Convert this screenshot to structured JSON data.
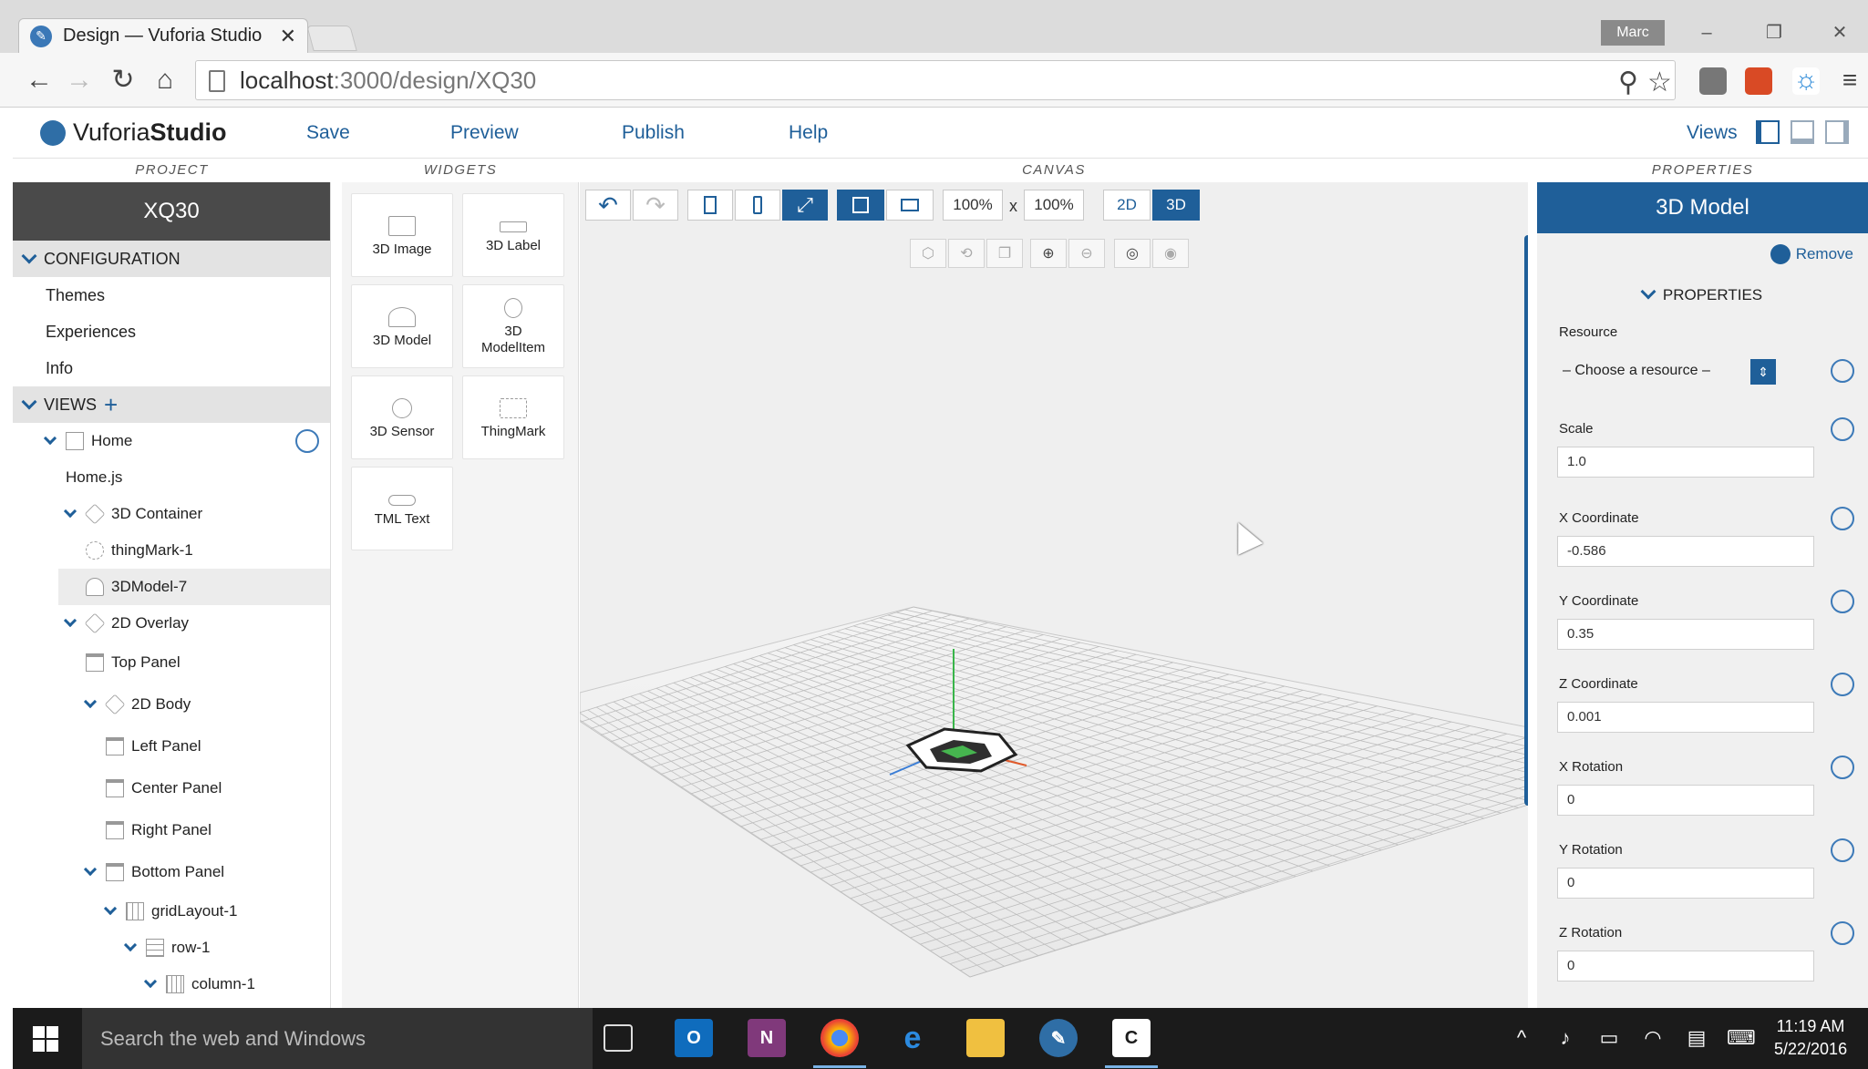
{
  "browser": {
    "tab_title": "Design — Vuforia Studio",
    "tab_close": "✕",
    "user": "Marc",
    "url_host": "localhost",
    "url_path": ":3000/design/XQ30"
  },
  "app": {
    "logo_prefix": "Vuforia",
    "logo_suffix": "Studio",
    "menu": {
      "save": "Save",
      "preview": "Preview",
      "publish": "Publish",
      "help": "Help"
    },
    "views_label": "Views"
  },
  "columns": {
    "project": "PROJECT",
    "widgets": "WIDGETS",
    "canvas": "CANVAS",
    "properties": "PROPERTIES"
  },
  "project": {
    "name": "XQ30",
    "configuration_label": "CONFIGURATION",
    "configuration_items": [
      "Themes",
      "Experiences",
      "Info"
    ],
    "views_label": "VIEWS",
    "tree": {
      "home": "Home",
      "home_js": "Home.js",
      "container_3d": "3D Container",
      "thingmark": "thingMark-1",
      "model": "3DModel-7",
      "overlay_2d": "2D Overlay",
      "top_panel": "Top Panel",
      "body_2d": "2D Body",
      "left_panel": "Left Panel",
      "center_panel": "Center Panel",
      "right_panel": "Right Panel",
      "bottom_panel": "Bottom Panel",
      "grid_layout": "gridLayout-1",
      "row": "row-1",
      "column": "column-1"
    }
  },
  "widgets": [
    {
      "label1": "3D Image",
      "label2": ""
    },
    {
      "label1": "3D Label",
      "label2": ""
    },
    {
      "label1": "3D Model",
      "label2": ""
    },
    {
      "label1": "3D",
      "label2": "ModelItem"
    },
    {
      "label1": "3D Sensor",
      "label2": ""
    },
    {
      "label1": "ThingMark",
      "label2": ""
    },
    {
      "label1": "TML Text",
      "label2": ""
    }
  ],
  "canvas": {
    "zoom_width": "100%",
    "zoom_height": "100%",
    "times": "x",
    "mode_2d": "2D",
    "mode_3d": "3D"
  },
  "properties": {
    "title": "3D Model",
    "remove": "Remove",
    "section": "PROPERTIES",
    "resource_label": "Resource",
    "resource_value": "– Choose a resource –",
    "fields": [
      {
        "label": "Scale",
        "value": "1.0"
      },
      {
        "label": "X Coordinate",
        "value": "-0.586"
      },
      {
        "label": "Y Coordinate",
        "value": "0.35"
      },
      {
        "label": "Z Coordinate",
        "value": "0.001"
      },
      {
        "label": "X Rotation",
        "value": "0"
      },
      {
        "label": "Y Rotation",
        "value": "0"
      },
      {
        "label": "Z Rotation",
        "value": "0"
      }
    ]
  },
  "taskbar": {
    "search_placeholder": "Search the web and Windows",
    "time": "11:19 AM",
    "date": "5/22/2016"
  },
  "colors": {
    "accent": "#1f5f99",
    "project_header": "#4a4a4a",
    "taskbar": "#1b1b1b"
  }
}
